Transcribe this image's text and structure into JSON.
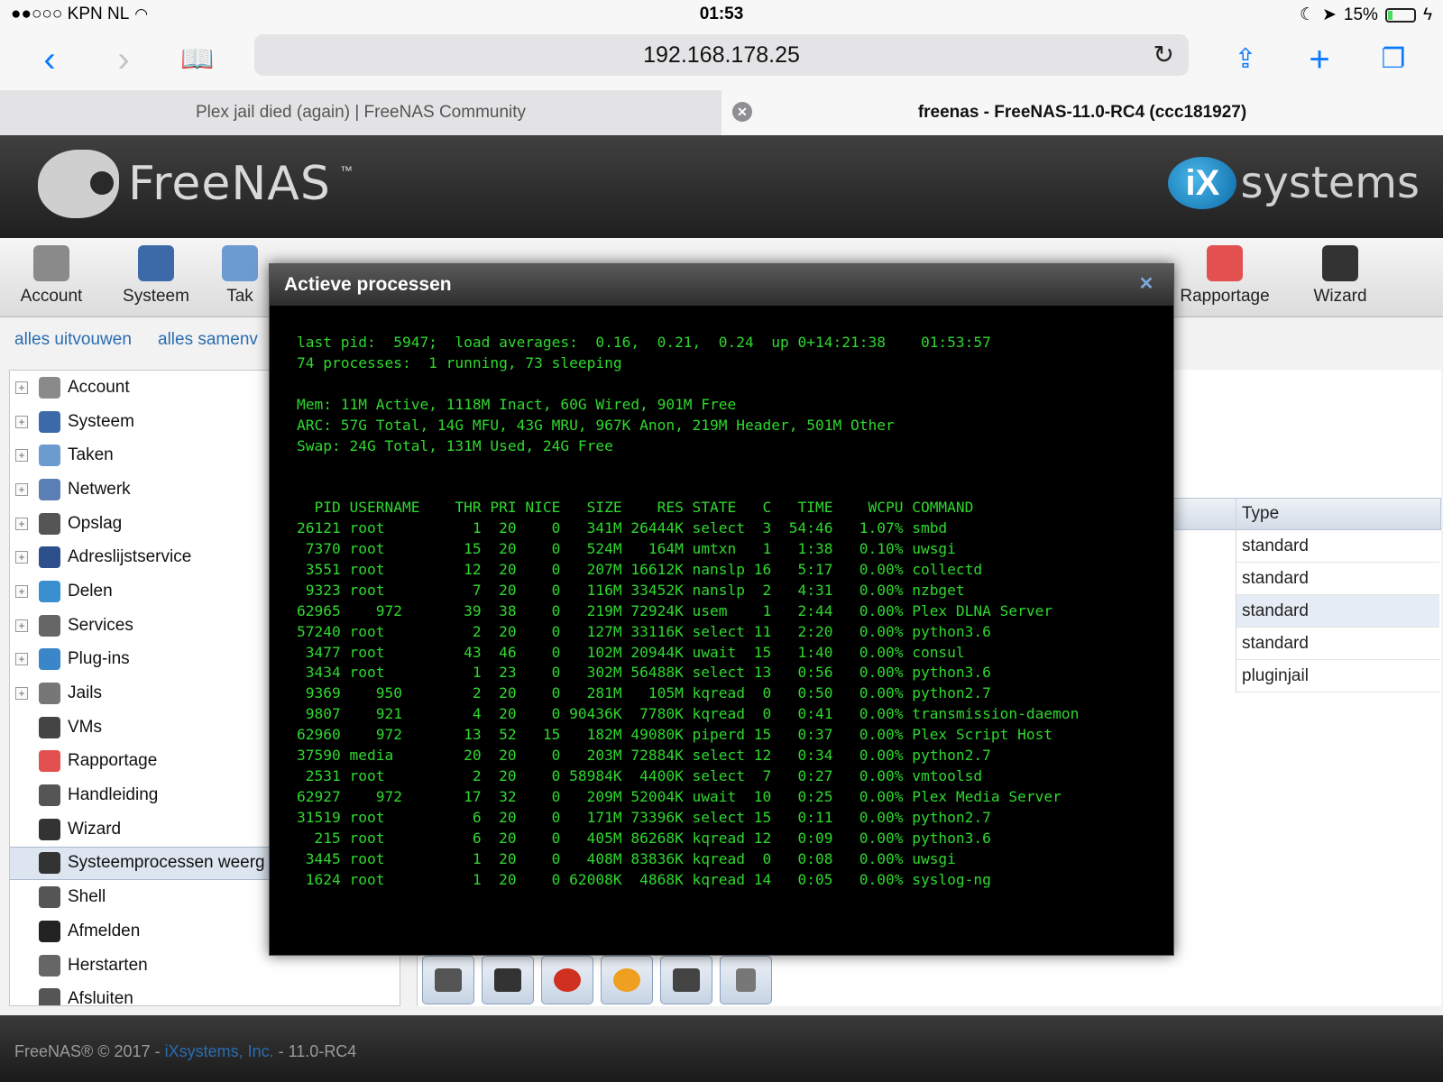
{
  "status_bar": {
    "carrier": "●●○○○ KPN NL",
    "time": "01:53",
    "battery": "15%"
  },
  "browser": {
    "url": "192.168.178.25",
    "tabs": [
      {
        "label": "Plex jail died (again) | FreeNAS Community",
        "active": false
      },
      {
        "label": "freenas - FreeNAS-11.0-RC4 (ccc181927)",
        "active": true
      }
    ]
  },
  "header": {
    "logo_text": "FreeNAS",
    "logo_tm": "™",
    "partner_logo_mark": "iX",
    "partner_logo_text": "systems"
  },
  "topnav": {
    "items": [
      {
        "label": "Account",
        "color": "#8a8a8a"
      },
      {
        "label": "Systeem",
        "color": "#3c6aa8"
      },
      {
        "label": "Tak",
        "color": "#6c9ccf"
      },
      {
        "label": "Rapportage",
        "color": "#e35050"
      },
      {
        "label": "Wizard",
        "color": "#333333"
      }
    ]
  },
  "subnav": {
    "expand_all": "alles uitvouwen",
    "collapse_all": "alles samenv"
  },
  "tree": {
    "items": [
      {
        "label": "Account",
        "expandable": true,
        "color": "#8a8a8a"
      },
      {
        "label": "Systeem",
        "expandable": true,
        "color": "#3c6aa8"
      },
      {
        "label": "Taken",
        "expandable": true,
        "color": "#6c9ccf"
      },
      {
        "label": "Netwerk",
        "expandable": true,
        "color": "#5b7fb5"
      },
      {
        "label": "Opslag",
        "expandable": true,
        "color": "#555555"
      },
      {
        "label": "Adreslijstservice",
        "expandable": true,
        "color": "#2d4f8c"
      },
      {
        "label": "Delen",
        "expandable": true,
        "color": "#3a8fd0"
      },
      {
        "label": "Services",
        "expandable": true,
        "color": "#666666"
      },
      {
        "label": "Plug-ins",
        "expandable": true,
        "color": "#3b86c9"
      },
      {
        "label": "Jails",
        "expandable": true,
        "color": "#777777"
      },
      {
        "label": "VMs",
        "expandable": false,
        "color": "#444444"
      },
      {
        "label": "Rapportage",
        "expandable": false,
        "color": "#e35050"
      },
      {
        "label": "Handleiding",
        "expandable": false,
        "color": "#555555"
      },
      {
        "label": "Wizard",
        "expandable": false,
        "color": "#333333"
      },
      {
        "label": "Systeemprocessen weerg",
        "expandable": false,
        "color": "#333333",
        "selected": true
      },
      {
        "label": "Shell",
        "expandable": false,
        "color": "#555555"
      },
      {
        "label": "Afmelden",
        "expandable": false,
        "color": "#222222"
      },
      {
        "label": "Herstarten",
        "expandable": false,
        "color": "#666666"
      },
      {
        "label": "Afsluiten",
        "expandable": false,
        "color": "#555555"
      }
    ]
  },
  "jails_table": {
    "type_header": "Type",
    "types": [
      "standard",
      "standard",
      "standard",
      "standard",
      "pluginjail"
    ]
  },
  "modal": {
    "title": "Actieve processen",
    "close_icon": "close-icon",
    "lines": [
      "last pid:  5947;  load averages:  0.16,  0.21,  0.24  up 0+14:21:38    01:53:57",
      "74 processes:  1 running, 73 sleeping",
      "",
      "Mem: 11M Active, 1118M Inact, 60G Wired, 901M Free",
      "ARC: 57G Total, 14G MFU, 43G MRU, 967K Anon, 219M Header, 501M Other",
      "Swap: 24G Total, 131M Used, 24G Free",
      "",
      "",
      "  PID USERNAME    THR PRI NICE   SIZE    RES STATE   C   TIME    WCPU COMMAND",
      "26121 root          1  20    0   341M 26444K select  3  54:46   1.07% smbd",
      " 7370 root         15  20    0   524M   164M umtxn   1   1:38   0.10% uwsgi",
      " 3551 root         12  20    0   207M 16612K nanslp 16   5:17   0.00% collectd",
      " 9323 root          7  20    0   116M 33452K nanslp  2   4:31   0.00% nzbget",
      "62965    972       39  38    0   219M 72924K usem    1   2:44   0.00% Plex DLNA Server",
      "57240 root          2  20    0   127M 33116K select 11   2:20   0.00% python3.6",
      " 3477 root         43  46    0   102M 20944K uwait  15   1:40   0.00% consul",
      " 3434 root          1  23    0   302M 56488K select 13   0:56   0.00% python3.6",
      " 9369    950        2  20    0   281M   105M kqread  0   0:50   0.00% python2.7",
      " 9807    921        4  20    0 90436K  7780K kqread  0   0:41   0.00% transmission-daemon",
      "62960    972       13  52   15   182M 49080K piperd 15   0:37   0.00% Plex Script Host",
      "37590 media        20  20    0   203M 72884K select 12   0:34   0.00% python2.7",
      " 2531 root          2  20    0 58984K  4400K select  7   0:27   0.00% vmtoolsd",
      "62927    972       17  32    0   209M 52004K uwait  10   0:25   0.00% Plex Media Server",
      "31519 root          6  20    0   171M 73396K select 15   0:11   0.00% python2.7",
      "  215 root          6  20    0   405M 86268K kqread 12   0:09   0.00% python3.6",
      " 3445 root          1  20    0   408M 83836K kqread  0   0:08   0.00% uwsgi",
      " 1624 root          1  20    0 62008K  4868K kqread 14   0:05   0.00% syslog-ng"
    ]
  },
  "toolbar_buttons": [
    {
      "icon": "wrench-icon",
      "color": "#555555"
    },
    {
      "icon": "folder-icon",
      "color": "#333333"
    },
    {
      "icon": "stop-icon",
      "color": "#d03020"
    },
    {
      "icon": "restart-icon",
      "color": "#f0a020"
    },
    {
      "icon": "shell-icon",
      "color": "#444444"
    },
    {
      "icon": "trash-icon",
      "color": "#777777"
    }
  ],
  "footer": {
    "copyright": "FreeNAS® © 2017 - ",
    "company": "iXsystems, Inc.",
    "version": " - 11.0-RC4"
  }
}
